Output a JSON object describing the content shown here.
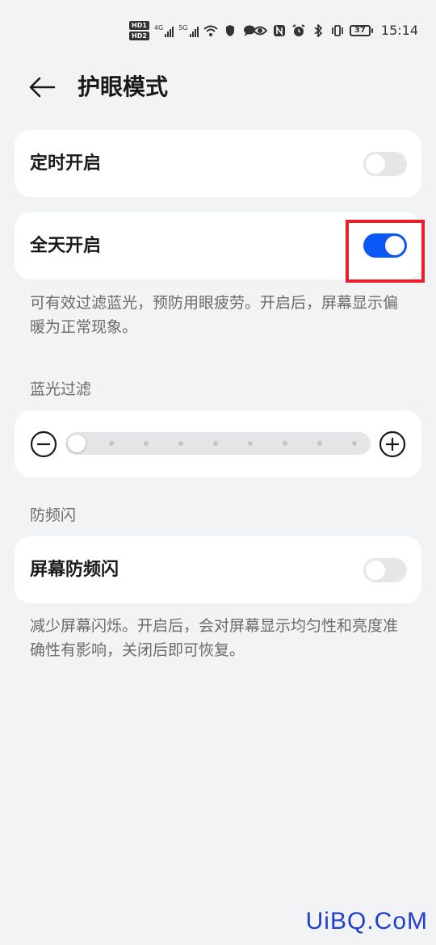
{
  "status_bar": {
    "hd_badges": [
      "HD1",
      "HD2"
    ],
    "signal1_label": "4G",
    "signal2_label": "5G",
    "battery": "37",
    "time": "15:14"
  },
  "header": {
    "title": "护眼模式",
    "back_icon": "arrow-left-icon"
  },
  "scheduled": {
    "label": "定时开启",
    "enabled": false
  },
  "all_day": {
    "label": "全天开启",
    "enabled": true,
    "description": "可有效过滤蓝光，预防用眼疲劳。开启后，屏幕显示偏暖为正常现象。"
  },
  "blue_light": {
    "section_title": "蓝光过滤",
    "minus_icon": "minus-circle-icon",
    "plus_icon": "plus-circle-icon",
    "level": 0
  },
  "flicker": {
    "section_title": "防频闪",
    "label": "屏幕防频闪",
    "enabled": false,
    "description": "减少屏幕闪烁。开启后，会对屏幕显示均匀性和亮度准确性有影响，关闭后即可恢复。"
  },
  "colors": {
    "accent": "#0a59f7",
    "highlight": "#e8202a",
    "watermark": "#1f3fd3"
  },
  "watermark": "UiBQ.CoM"
}
